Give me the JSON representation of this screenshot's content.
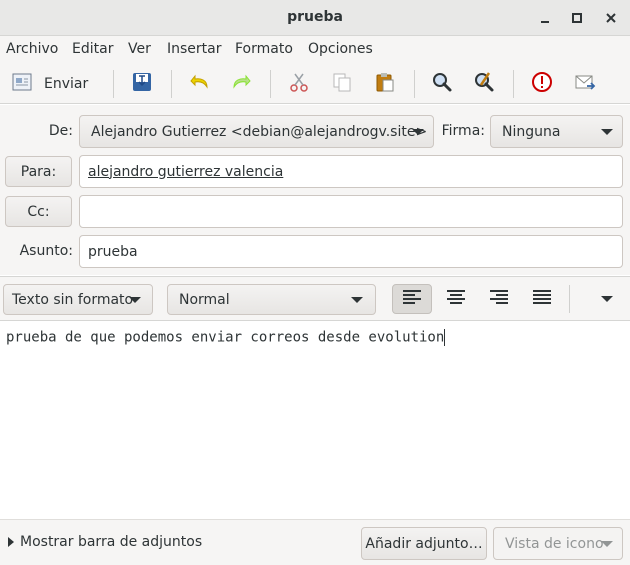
{
  "window": {
    "title": "prueba"
  },
  "menu": [
    "Archivo",
    "Editar",
    "Ver",
    "Insertar",
    "Formato",
    "Opciones"
  ],
  "toolbar": {
    "send_label": "Enviar"
  },
  "headers": {
    "from_label": "De:",
    "from_value": "Alejandro Gutierrez <debian@alejandrogv.site>",
    "signature_label": "Firma:",
    "signature_value": "Ninguna",
    "to_button": "Para:",
    "to_value": "alejandro gutierrez valencia",
    "cc_button": "Cc:",
    "cc_value": "",
    "subject_label": "Asunto:",
    "subject_value": "prueba"
  },
  "format": {
    "mode": "Texto sin formato",
    "paragraph_style": "Normal",
    "alignment_selected": "left"
  },
  "body": {
    "text": "prueba de que podemos enviar correos desde evolution"
  },
  "bottom": {
    "attachments_toggle": "Mostrar barra de adjuntos",
    "add_attachment": "Añadir adjunto…",
    "view_mode": "Vista de icono"
  },
  "colors": {
    "accent_red": "#cc0000",
    "icon_blue": "#3465a4",
    "undo_yellow": "#edd400",
    "redo_green": "#73d216"
  }
}
